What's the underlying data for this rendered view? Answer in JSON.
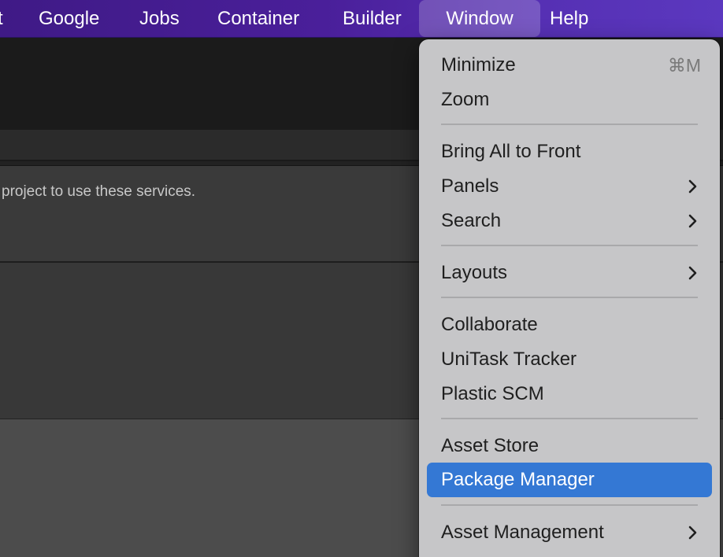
{
  "menubar": {
    "items": [
      {
        "label": "t"
      },
      {
        "label": "Google"
      },
      {
        "label": "Jobs"
      },
      {
        "label": "Container"
      },
      {
        "label": "Builder"
      },
      {
        "label": "Window"
      },
      {
        "label": "Help"
      }
    ],
    "active": "Window"
  },
  "background": {
    "panel_message": "project to use these services."
  },
  "window_menu": {
    "items": [
      {
        "label": "Minimize",
        "shortcut": "⌘M"
      },
      {
        "label": "Zoom"
      },
      {
        "label": "Bring All to Front"
      },
      {
        "label": "Panels",
        "submenu": true
      },
      {
        "label": "Search",
        "submenu": true
      },
      {
        "label": "Layouts",
        "submenu": true
      },
      {
        "label": "Collaborate"
      },
      {
        "label": "UniTask Tracker"
      },
      {
        "label": "Plastic SCM"
      },
      {
        "label": "Asset Store"
      },
      {
        "label": "Package Manager",
        "highlighted": true
      },
      {
        "label": "Asset Management",
        "submenu": true
      }
    ]
  },
  "colors": {
    "menubar_accent": "#4a1f9a",
    "menu_highlight": "#3478d4",
    "menu_background": "#c6c6c8"
  }
}
